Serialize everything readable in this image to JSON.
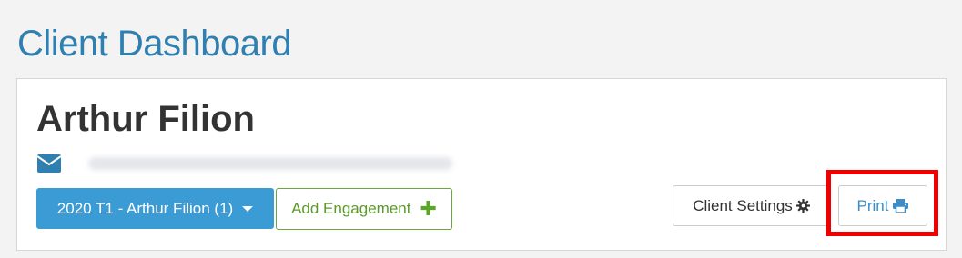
{
  "page": {
    "title": "Client Dashboard"
  },
  "client": {
    "name": "Arthur Filion",
    "email_icon": "envelope-icon"
  },
  "actions": {
    "engagement_select_label": "2020 T1 - Arthur Filion (1)",
    "add_engagement_label": "Add Engagement",
    "client_settings_label": "Client Settings",
    "print_label": "Print"
  },
  "colors": {
    "title": "#2f7fb0",
    "engagement_button": "#3a9bd5",
    "add_engagement": "#5a9a2a",
    "print": "#3a8dc8",
    "highlight": "#ee0000"
  }
}
